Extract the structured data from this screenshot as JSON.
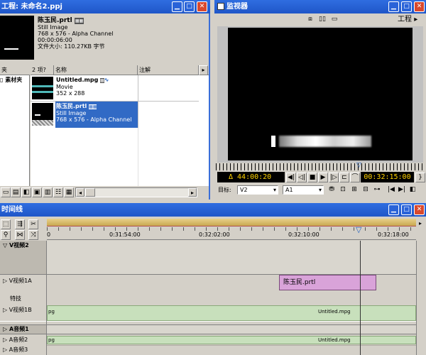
{
  "project": {
    "title": "工程: 未命名2.ppj",
    "preview": {
      "name": "陈玉民.prtl",
      "type": "Still Image",
      "dims": "768 x 576 - Alpha Channel",
      "duration": "00:00:06:00",
      "size": "文件大小: 110.27KB 字节"
    },
    "bin_header": "夹",
    "bin_item": "素材夹",
    "columns": {
      "count": "2 项?",
      "name": "名称",
      "notes": "注解"
    },
    "items": [
      {
        "name": "Untitled.mpg",
        "type": "Movie",
        "dims": "352 x 288",
        "selected": false
      },
      {
        "name": "陈玉民.prtl",
        "type": "Still Image",
        "dims": "768 x 576 - Alpha Channel",
        "selected": true
      }
    ]
  },
  "monitor": {
    "title": "监视器",
    "menu_label": "工程",
    "duration": "Δ 44:00:20",
    "timecode": "00:32:15:00",
    "target_label": "目标:",
    "video_target": "V2",
    "audio_target": "A1"
  },
  "timeline": {
    "title": "时间线",
    "ruler": [
      "0",
      "0:31:54:00",
      "0:32:02:00",
      "0:32:10:00",
      "0:32:18:00"
    ],
    "tracks": [
      {
        "label": "▽ V视频2",
        "kind": "video-header"
      },
      {
        "label": "▷ V视频1A",
        "kind": "video"
      },
      {
        "label": "特技",
        "kind": "fx"
      },
      {
        "label": "▷ V视频1B",
        "kind": "video"
      },
      {
        "label": "▷ A音频1",
        "kind": "audio-header"
      },
      {
        "label": "▷ A音频2",
        "kind": "audio"
      },
      {
        "label": "▷ A音频3",
        "kind": "audio"
      }
    ],
    "clips": {
      "title_clip": "陈玉民.prtl",
      "mpg_left": "pg",
      "mpg_right": "Untitled.mpg",
      "audio_left": "pg",
      "audio_right": "Untitled.mpg"
    }
  },
  "colors": {
    "titlebar": "#1f56c8",
    "selected": "#316ac5",
    "video_clip": "#c8e0bc",
    "title_clip": "#d9a3d9",
    "close": "#d9492d"
  }
}
